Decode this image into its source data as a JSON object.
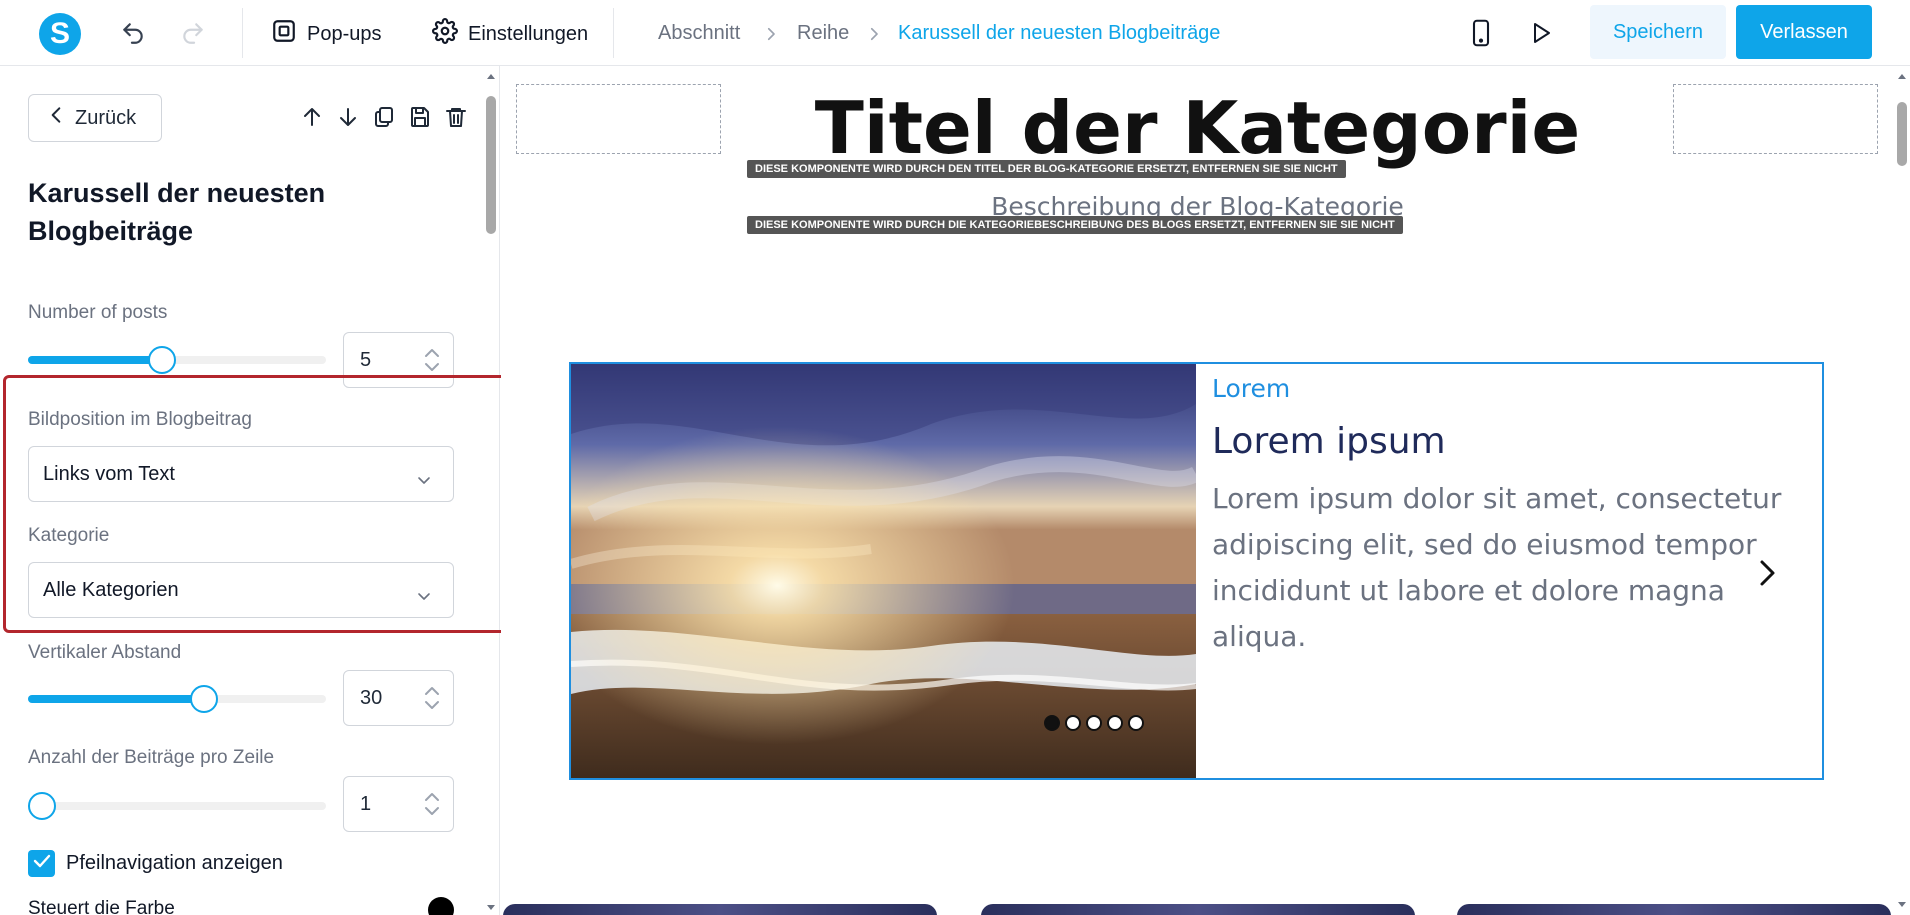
{
  "topbar": {
    "logo": "S",
    "popups_label": "Pop-ups",
    "settings_label": "Einstellungen",
    "breadcrumb": [
      "Abschnitt",
      "Reihe",
      "Karussell der neuesten Blogbeiträge"
    ],
    "save_label": "Speichern",
    "exit_label": "Verlassen",
    "icons": [
      "undo-icon",
      "redo-icon",
      "popup-icon",
      "gear-icon",
      "mobile-icon",
      "play-icon"
    ]
  },
  "panel": {
    "back_label": "Zurück",
    "title": "Karussell der neuesten Blogbeiträge",
    "tool_icons": [
      "arrow-up-icon",
      "arrow-down-icon",
      "copy-icon",
      "save-icon",
      "trash-icon"
    ],
    "number_of_posts": {
      "label": "Number of posts",
      "value": "5",
      "slider_fraction": 0.45
    },
    "image_position": {
      "label": "Bildposition im Blogbeitrag",
      "value": "Links vom Text"
    },
    "category": {
      "label": "Kategorie",
      "value": "Alle Kategorien"
    },
    "vertical_spacing": {
      "label": "Vertikaler Abstand",
      "value": "30",
      "slider_fraction": 0.59
    },
    "posts_per_row": {
      "label": "Anzahl der Beiträge pro Zeile",
      "value": "1",
      "slider_fraction": 0.0
    },
    "arrow_nav": {
      "label": "Pfeilnavigation anzeigen",
      "checked": true
    },
    "color_control": {
      "label": "Steuert die Farbe",
      "color": "#000000"
    }
  },
  "canvas": {
    "category_title": "Titel der Kategorie",
    "title_notice": "DIESE KOMPONENTE WIRD DURCH DEN TITEL DER BLOG-KATEGORIE ERSETZT, ENTFERNEN SIE SIE NICHT",
    "category_description": "Beschreibung der Blog-Kategorie",
    "description_notice": "DIESE KOMPONENTE WIRD DURCH DIE KATEGORIEBESCHREIBUNG DES BLOGS ERSETZT, ENTFERNEN SIE SIE NICHT",
    "card": {
      "category": "Lorem",
      "heading": "Lorem ipsum",
      "body": "Lorem ipsum dolor sit amet, consectetur adipiscing elit, sed do eiusmod tempor incididunt ut labore et dolore magna aliqua.",
      "dots_total": 5,
      "dots_active": 1
    }
  },
  "colors": {
    "accent": "#0ea5e9",
    "highlight": "#b3262d",
    "card_border": "#1f8fe0"
  }
}
